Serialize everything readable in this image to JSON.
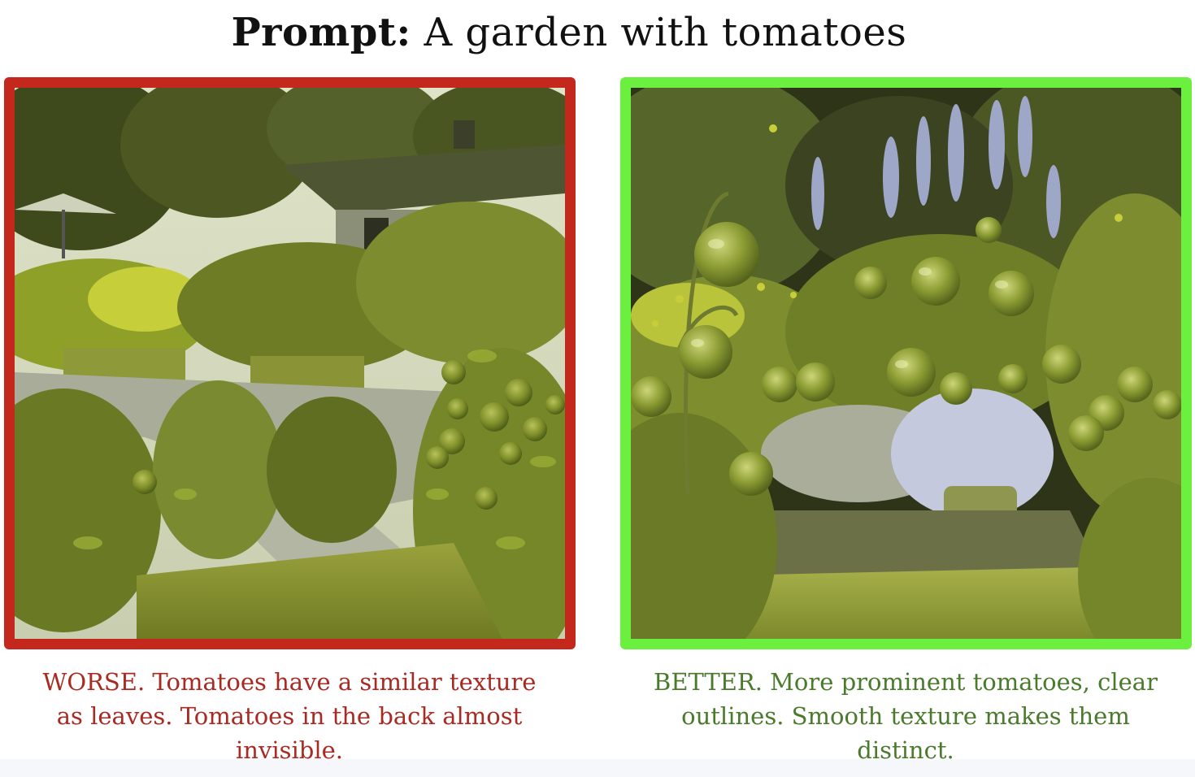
{
  "title": {
    "label": "Prompt:",
    "text": "A garden with tomatoes"
  },
  "left_panel": {
    "caption": "WORSE. Tomatoes have a similar texture as leaves. Tomatoes in the back almost invisible.",
    "border_color": "#c4281c",
    "caption_color": "#a82a22"
  },
  "right_panel": {
    "caption": "BETTER. More prominent tomatoes, clear outlines. Smooth texture makes them distinct.",
    "border_color": "#6cf03f",
    "caption_color": "#4a7a2c"
  }
}
